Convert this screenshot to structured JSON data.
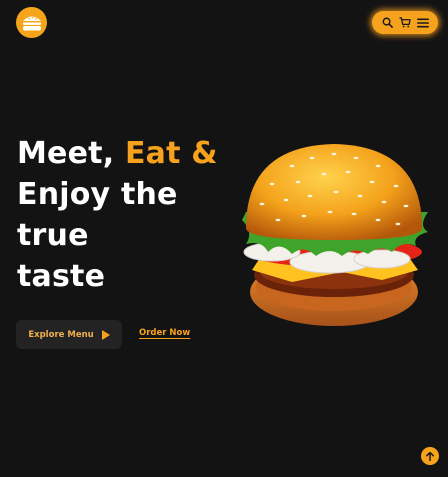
{
  "header": {
    "logo_icon": "burger-logo-icon",
    "nav_icons": [
      "search-icon",
      "cart-icon",
      "menu-icon"
    ],
    "accent_color": "#f7a21c"
  },
  "hero": {
    "title_line1_plain": "Meet, ",
    "title_line1_accent": "Eat &",
    "title_line2": "Enjoy the",
    "title_line3": "true",
    "title_line4": "taste",
    "explore_label": "Explore Menu",
    "order_label": "Order Now",
    "image_icon": "burger-image"
  },
  "footer": {
    "scroll_top_icon": "arrow-up-icon"
  }
}
